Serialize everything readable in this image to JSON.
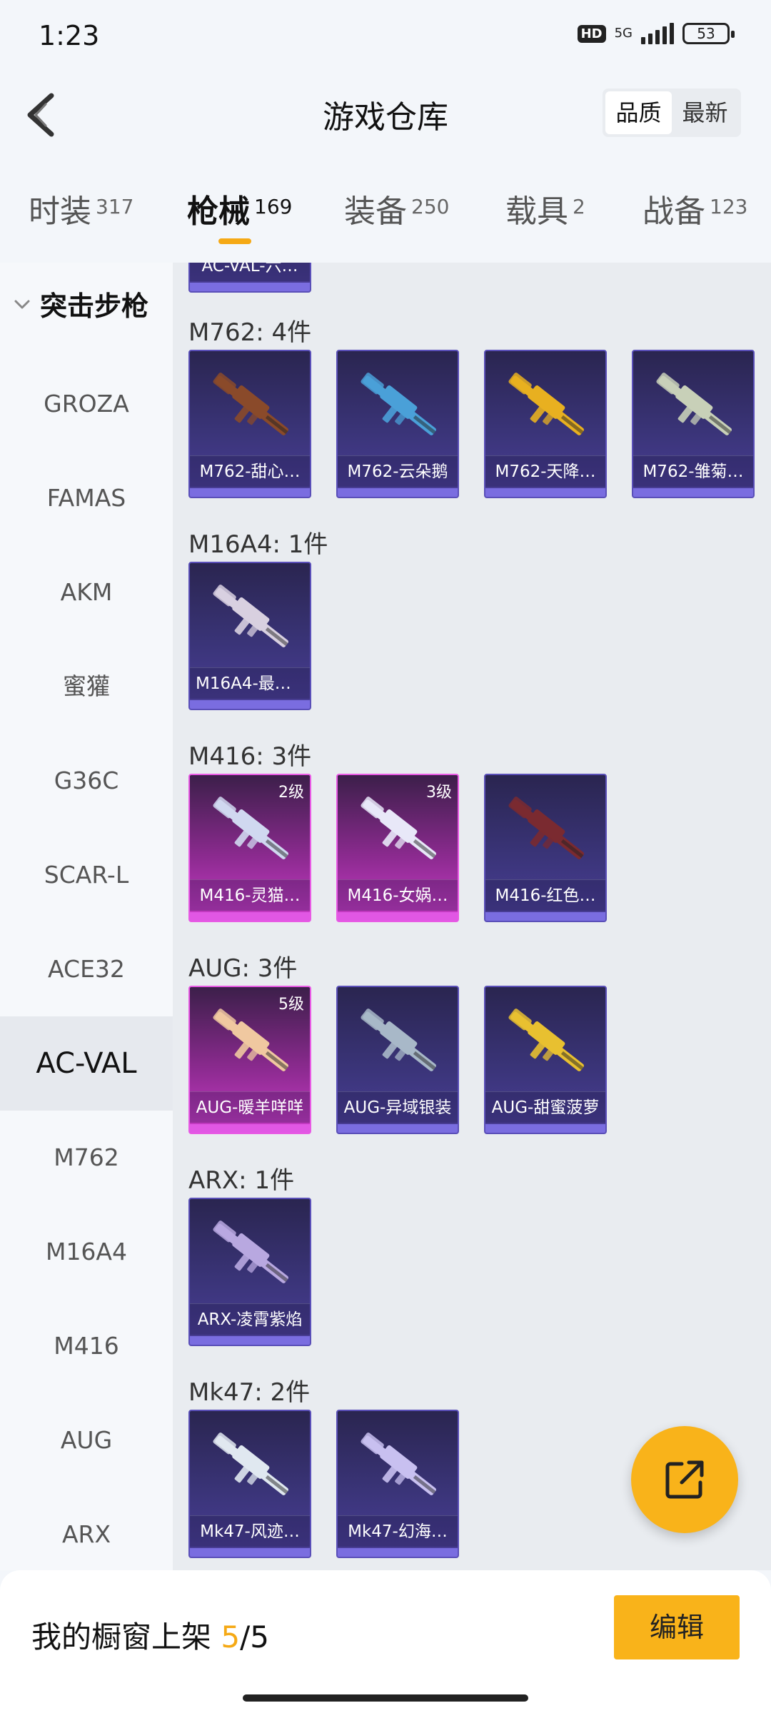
{
  "status": {
    "time": "1:23",
    "hd": "HD",
    "network": "5G",
    "battery": "53"
  },
  "header": {
    "title": "游戏仓库",
    "sort_quality": "品质",
    "sort_newest": "最新"
  },
  "tabs": [
    {
      "label": "时装",
      "count": "317"
    },
    {
      "label": "枪械",
      "count": "169"
    },
    {
      "label": "装备",
      "count": "250"
    },
    {
      "label": "载具",
      "count": "2"
    },
    {
      "label": "战备",
      "count": "123"
    }
  ],
  "sidebar": {
    "category": "突击步枪",
    "items": [
      "GROZA",
      "FAMAS",
      "AKM",
      "蜜獾",
      "G36C",
      "SCAR-L",
      "ACE32",
      "AC-VAL",
      "M762",
      "M16A4",
      "M416",
      "AUG",
      "ARX"
    ]
  },
  "content": {
    "top_partial": "AC-VAL-六…",
    "groups": [
      {
        "title": "M762: 4件",
        "items": [
          {
            "label": "M762-甜心…",
            "color": "#8a4a2a"
          },
          {
            "label": "M762-云朵鹅",
            "color": "#4aa0d8"
          },
          {
            "label": "M762-天降…",
            "color": "#e8b020"
          },
          {
            "label": "M762-雏菊…",
            "color": "#c8d0b8"
          }
        ]
      },
      {
        "title": "M16A4: 1件",
        "items": [
          {
            "label": "M16A4-最终…",
            "color": "#d8d0e0"
          }
        ]
      },
      {
        "title": "M416: 3件",
        "items": [
          {
            "label": "M416-灵猫…",
            "color": "#d0d8f0",
            "level": "2级",
            "pink": true
          },
          {
            "label": "M416-女娲…",
            "color": "#e8e8f8",
            "level": "3级",
            "pink": true
          },
          {
            "label": "M416-红色…",
            "color": "#7a2a30"
          }
        ]
      },
      {
        "title": "AUG: 3件",
        "items": [
          {
            "label": "AUG-暖羊咩咩",
            "color": "#f0c8a0",
            "level": "5级",
            "pink": true
          },
          {
            "label": "AUG-异域银装",
            "color": "#a8b8c8"
          },
          {
            "label": "AUG-甜蜜菠萝",
            "color": "#e8c030"
          }
        ]
      },
      {
        "title": "ARX: 1件",
        "items": [
          {
            "label": "ARX-凌霄紫焰",
            "color": "#b8a8e0"
          }
        ]
      },
      {
        "title": "Mk47: 2件",
        "items": [
          {
            "label": "Mk47-风迹…",
            "color": "#e0e8f0"
          },
          {
            "label": "Mk47-幻海…",
            "color": "#c8c0f0"
          }
        ]
      }
    ]
  },
  "bottom": {
    "shop_prefix": "我的橱窗上架 ",
    "shop_count": "5",
    "shop_total": "/5",
    "edit_label": "编辑"
  }
}
